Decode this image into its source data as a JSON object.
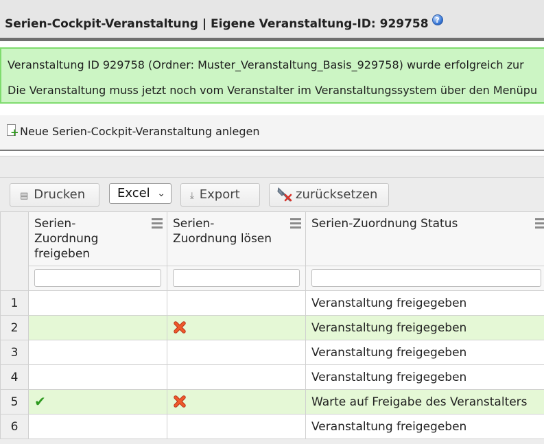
{
  "header": {
    "title": "Serien-Cockpit-Veranstaltung | Eigene Veranstaltung-ID: 929758",
    "help_icon": "?"
  },
  "message": {
    "line1": "Veranstaltung ID 929758 (Ordner: Muster_Veranstaltung_Basis_929758) wurde erfolgreich zur",
    "line2": "Die Veranstaltung muss jetzt noch vom Veranstalter im Veranstaltungssystem über den Menüpu"
  },
  "new_link": {
    "label": "Neue Serien-Cockpit-Veranstaltung anlegen",
    "icon": "document-plus-icon"
  },
  "toolbar": {
    "print_label": "Drucken",
    "format_selected": "Excel",
    "export_label": "Export",
    "reset_label": "zurücksetzen"
  },
  "columns": [
    "Serien-Zuordnung freigeben",
    "Serien-Zuordnung lösen",
    "Serien-Zuordnung Status"
  ],
  "rows": [
    {
      "num": "1",
      "freigeben": "",
      "loesen": "",
      "status": "Veranstaltung freigegeben"
    },
    {
      "num": "2",
      "freigeben": "",
      "loesen": "x",
      "status": "Veranstaltung freigegeben"
    },
    {
      "num": "3",
      "freigeben": "",
      "loesen": "",
      "status": "Veranstaltung freigegeben"
    },
    {
      "num": "4",
      "freigeben": "",
      "loesen": "",
      "status": "Veranstaltung freigegeben"
    },
    {
      "num": "5",
      "freigeben": "check",
      "loesen": "x",
      "status": "Warte auf Freigabe des Veranstalters"
    },
    {
      "num": "6",
      "freigeben": "",
      "loesen": "",
      "status": "Veranstaltung freigegeben"
    }
  ],
  "colors": {
    "success_bg": "#ccf5c4",
    "success_border": "#7fdc6e",
    "highlight_row": "#e5f8d6",
    "check_green": "#2f9a20",
    "x_red": "#e0441c"
  }
}
